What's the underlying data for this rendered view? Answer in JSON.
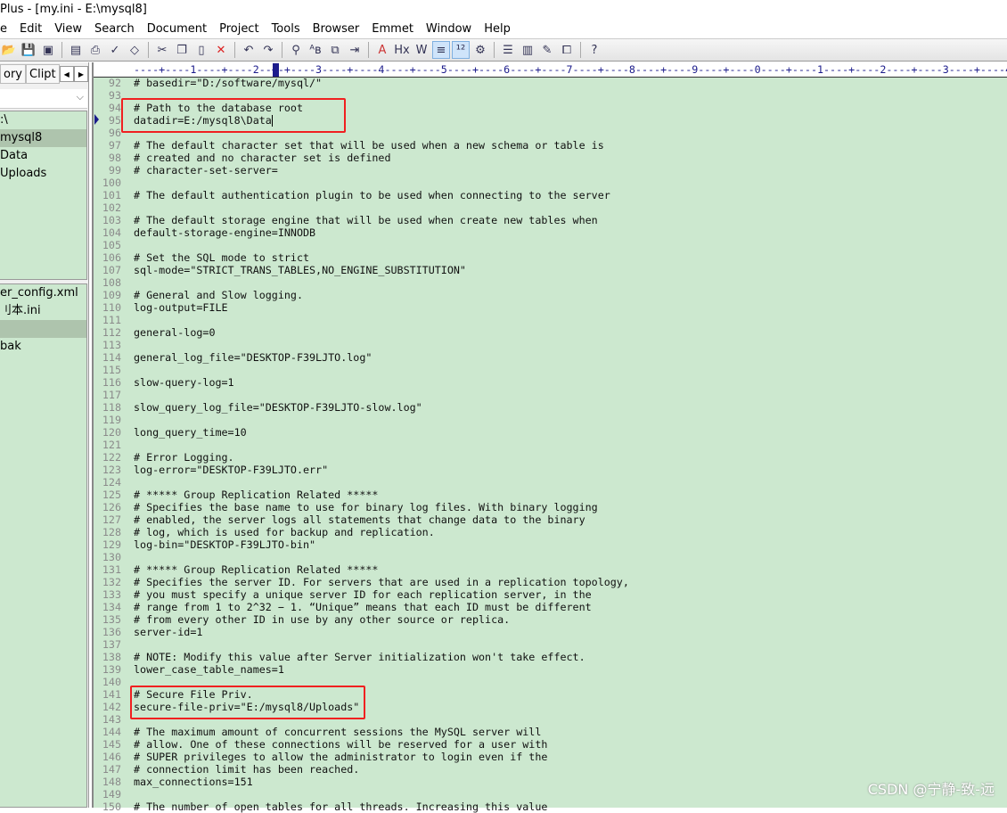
{
  "window": {
    "title": "Plus - [my.ini - E:\\mysql8]"
  },
  "menu": [
    "e",
    "Edit",
    "View",
    "Search",
    "Document",
    "Project",
    "Tools",
    "Browser",
    "Emmet",
    "Window",
    "Help"
  ],
  "toolbar": [
    "open-icon",
    "save-icon",
    "save-all-icon",
    "|",
    "print-preview-icon",
    "print-icon",
    "spellcheck-icon",
    "browser-preview-icon",
    "|",
    "cut-icon",
    "copy-icon",
    "paste-icon",
    "delete-icon",
    "|",
    "undo-icon",
    "redo-icon",
    "|",
    "find-icon",
    "replace-icon",
    "find-in-files-icon",
    "goto-line-icon",
    "|",
    "font-icon",
    "hex-icon",
    "word-wrap-icon",
    "indent-guide-icon",
    "line-numbers-icon",
    "settings-icon",
    "|",
    "list-icon",
    "output-window-icon",
    "clip-icon",
    "window-icon",
    "|",
    "help-icon"
  ],
  "left": {
    "tabs": [
      "ory",
      "Clipt"
    ],
    "tree": [
      ":\\",
      "mysql8",
      "Data",
      "Uploads"
    ],
    "tree_selected": 1,
    "files": [
      "er_config.xml",
      "刂本.ini",
      "",
      "bak"
    ],
    "files_selected": 2
  },
  "ruler": "----+----1----+----2--+-+----3----+----4----+----5----+----6----+----7----+----8----+----9----+----0----+----1----+----2----+----3----+----4",
  "editor": {
    "lines": [
      {
        "n": "92",
        "t": "# basedir=\"D:/software/mysql/\""
      },
      {
        "n": "93",
        "t": ""
      },
      {
        "n": "94",
        "t": "# Path to the database root"
      },
      {
        "n": "95",
        "t": "datadir=E:/mysql8\\Data"
      },
      {
        "n": "96",
        "t": ""
      },
      {
        "n": "97",
        "t": "# The default character set that will be used when a new schema or table is"
      },
      {
        "n": "98",
        "t": "# created and no character set is defined"
      },
      {
        "n": "99",
        "t": "# character-set-server="
      },
      {
        "n": "100",
        "t": ""
      },
      {
        "n": "101",
        "t": "# The default authentication plugin to be used when connecting to the server"
      },
      {
        "n": "102",
        "t": ""
      },
      {
        "n": "103",
        "t": "# The default storage engine that will be used when create new tables when"
      },
      {
        "n": "104",
        "t": "default-storage-engine=INNODB"
      },
      {
        "n": "105",
        "t": ""
      },
      {
        "n": "106",
        "t": "# Set the SQL mode to strict"
      },
      {
        "n": "107",
        "t": "sql-mode=\"STRICT_TRANS_TABLES,NO_ENGINE_SUBSTITUTION\""
      },
      {
        "n": "108",
        "t": ""
      },
      {
        "n": "109",
        "t": "# General and Slow logging."
      },
      {
        "n": "110",
        "t": "log-output=FILE"
      },
      {
        "n": "111",
        "t": ""
      },
      {
        "n": "112",
        "t": "general-log=0"
      },
      {
        "n": "113",
        "t": ""
      },
      {
        "n": "114",
        "t": "general_log_file=\"DESKTOP-F39LJTO.log\""
      },
      {
        "n": "115",
        "t": ""
      },
      {
        "n": "116",
        "t": "slow-query-log=1"
      },
      {
        "n": "117",
        "t": ""
      },
      {
        "n": "118",
        "t": "slow_query_log_file=\"DESKTOP-F39LJTO-slow.log\""
      },
      {
        "n": "119",
        "t": ""
      },
      {
        "n": "120",
        "t": "long_query_time=10"
      },
      {
        "n": "121",
        "t": ""
      },
      {
        "n": "122",
        "t": "# Error Logging."
      },
      {
        "n": "123",
        "t": "log-error=\"DESKTOP-F39LJTO.err\""
      },
      {
        "n": "124",
        "t": ""
      },
      {
        "n": "125",
        "t": "# ***** Group Replication Related *****"
      },
      {
        "n": "126",
        "t": "# Specifies the base name to use for binary log files. With binary logging"
      },
      {
        "n": "127",
        "t": "# enabled, the server logs all statements that change data to the binary"
      },
      {
        "n": "128",
        "t": "# log, which is used for backup and replication."
      },
      {
        "n": "129",
        "t": "log-bin=\"DESKTOP-F39LJTO-bin\""
      },
      {
        "n": "130",
        "t": ""
      },
      {
        "n": "131",
        "t": "# ***** Group Replication Related *****"
      },
      {
        "n": "132",
        "t": "# Specifies the server ID. For servers that are used in a replication topology,"
      },
      {
        "n": "133",
        "t": "# you must specify a unique server ID for each replication server, in the"
      },
      {
        "n": "134",
        "t": "# range from 1 to 2^32 − 1. “Unique” means that each ID must be different"
      },
      {
        "n": "135",
        "t": "# from every other ID in use by any other source or replica."
      },
      {
        "n": "136",
        "t": "server-id=1"
      },
      {
        "n": "137",
        "t": ""
      },
      {
        "n": "138",
        "t": "# NOTE: Modify this value after Server initialization won't take effect."
      },
      {
        "n": "139",
        "t": "lower_case_table_names=1"
      },
      {
        "n": "140",
        "t": ""
      },
      {
        "n": "141",
        "t": "# Secure File Priv."
      },
      {
        "n": "142",
        "t": "secure-file-priv=\"E:/mysql8/Uploads\""
      },
      {
        "n": "143",
        "t": ""
      },
      {
        "n": "144",
        "t": "# The maximum amount of concurrent sessions the MySQL server will"
      },
      {
        "n": "145",
        "t": "# allow. One of these connections will be reserved for a user with"
      },
      {
        "n": "146",
        "t": "# SUPER privileges to allow the administrator to login even if the"
      },
      {
        "n": "147",
        "t": "# connection limit has been reached."
      },
      {
        "n": "148",
        "t": "max_connections=151"
      },
      {
        "n": "149",
        "t": ""
      },
      {
        "n": "150",
        "t": "# The number of open tables for all threads. Increasing this value"
      }
    ],
    "current_line": "95"
  },
  "watermark": "CSDN @宁静-致-远",
  "colors": {
    "editor_bg": "#cce8cf",
    "highlight_box": "#f02020",
    "ruler_text": "#1c1c8c"
  }
}
